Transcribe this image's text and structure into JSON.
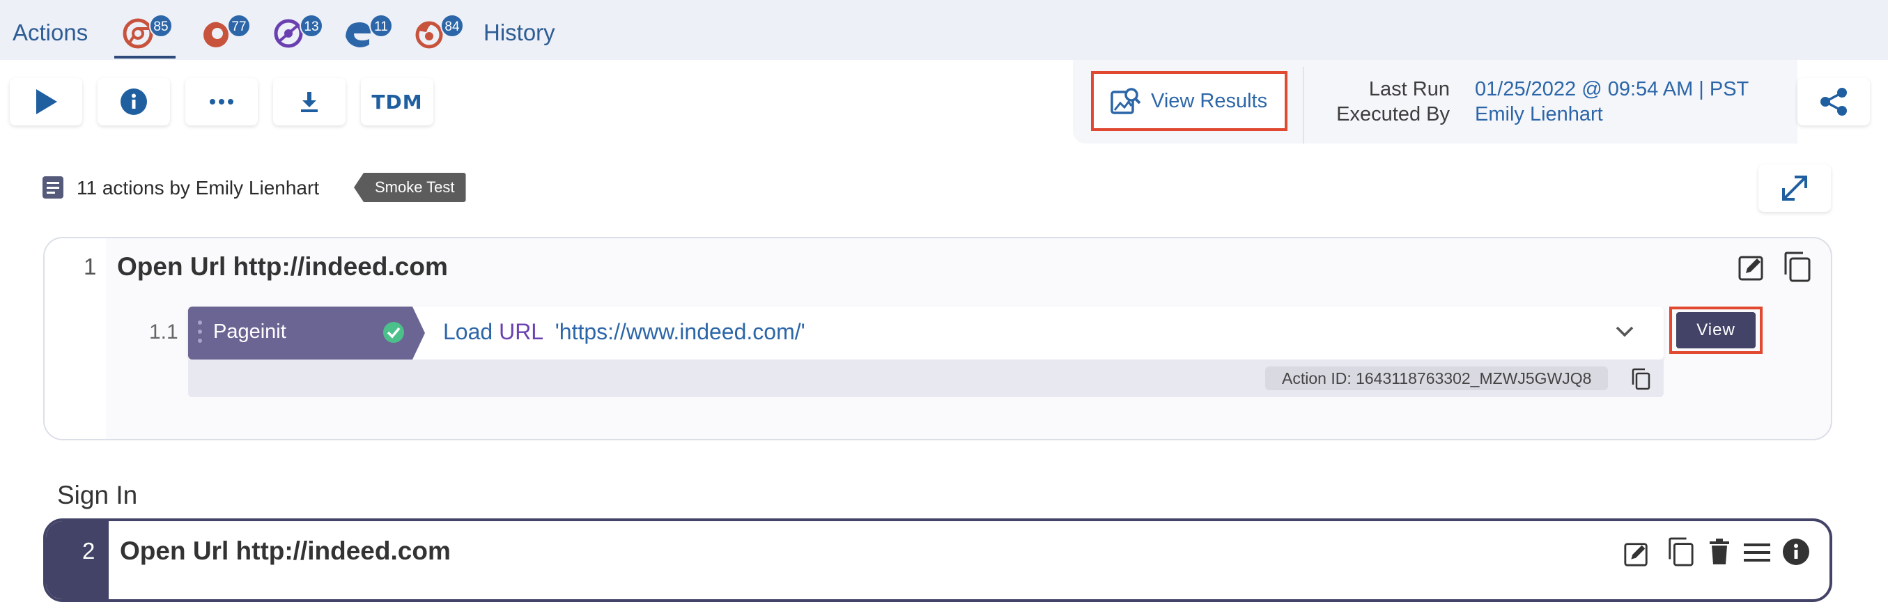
{
  "nav": {
    "actions_label": "Actions",
    "history_label": "History",
    "browser_tabs": [
      {
        "browser": "chrome",
        "count": "85",
        "color": "#c7533c"
      },
      {
        "browser": "firefox",
        "count": "77",
        "color": "#c7533c"
      },
      {
        "browser": "opera",
        "count": "13",
        "color": "#6a3fb0"
      },
      {
        "browser": "edge",
        "count": "11",
        "color": "#2c66a8"
      },
      {
        "browser": "safari",
        "count": "84",
        "color": "#c7533c"
      }
    ]
  },
  "toolbar": {
    "buttons": [
      "play-icon",
      "info-icon",
      "more-icon",
      "download-icon",
      "tdm"
    ],
    "tdm_label": "TDM",
    "view_results_label": "View Results",
    "last_run_label": "Last Run",
    "last_run_value": "01/25/2022 @ 09:54 AM | PST",
    "executed_by_label": "Executed By",
    "executed_by_value": "Emily Lienhart"
  },
  "summary": {
    "text": "11 actions by Emily Lienhart",
    "tag": "Smoke Test"
  },
  "steps": [
    {
      "number": "1",
      "title": "Open Url http://indeed.com",
      "sub": {
        "number": "1.1",
        "type_label": "Pageinit",
        "verb": "Load",
        "keyword": "URL",
        "value": "'https://www.indeed.com/'",
        "view_label": "View",
        "action_id": "Action ID: 1643118763302_MZWJ5GWJQ8"
      }
    }
  ],
  "group": {
    "title": "Sign In",
    "step": {
      "number": "2",
      "title": "Open Url http://indeed.com"
    }
  },
  "colors": {
    "accent": "#2c66a8",
    "highlight": "#e0482f",
    "pageinit": "#6b6594",
    "dark_button": "#434367",
    "success": "#4cc08a"
  }
}
